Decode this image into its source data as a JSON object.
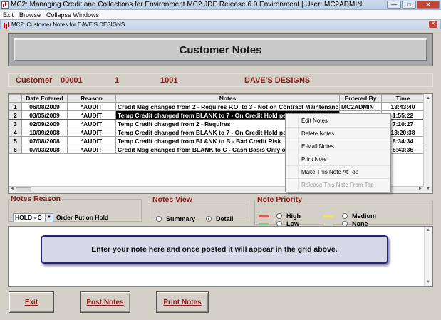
{
  "window": {
    "title": "MC2: Managing Credit and Collections for Environment MC2 JDE Release 6.0 Environment  |  User: MC2ADMIN",
    "minimize": "—",
    "maximize": "□",
    "close": "✕"
  },
  "menu": [
    "Exit",
    "Browse",
    "Collapse Windows"
  ],
  "child_window": {
    "title": "MC2: Customer Notes for DAVE'S DESIGNS",
    "close": "✕"
  },
  "header": {
    "title": "Customer Notes"
  },
  "customer": {
    "label": "Customer",
    "number": "00001",
    "field2": "1",
    "field3": "1001",
    "name": "DAVE'S DESIGNS"
  },
  "grid": {
    "columns": [
      "Date Entered",
      "Reason",
      "Notes",
      "Entered By",
      "Time"
    ],
    "rows": [
      {
        "n": "1",
        "date": "06/08/2009",
        "reason": "*AUDIT",
        "note": "Credit Msg changed from 2  - Requires P.O. to 3  - Not on Contract Maintenanc",
        "by": "MC2ADMIN",
        "time": "13:43:40"
      },
      {
        "n": "2",
        "date": "03/05/2009",
        "reason": "*AUDIT",
        "note": "Temp Credit changed from BLANK to 7  - On Credit Hold per",
        "by": "",
        "time": "1:55:22"
      },
      {
        "n": "3",
        "date": "02/09/2009",
        "reason": "*AUDIT",
        "note": "Temp Credit changed from 2  - Requires",
        "by": "",
        "time": "7:10:27"
      },
      {
        "n": "4",
        "date": "10/09/2008",
        "reason": "*AUDIT",
        "note": "Temp Credit changed from BLANK to 7  - On Credit Hold per",
        "by": "",
        "time": "13:20:38"
      },
      {
        "n": "5",
        "date": "07/08/2008",
        "reason": "*AUDIT",
        "note": "Temp Credit changed from BLANK to B  - Bad Credit Risk",
        "by": "",
        "time": "8:34:34"
      },
      {
        "n": "6",
        "date": "07/03/2008",
        "reason": "*AUDIT",
        "note": "Credit Msg changed from BLANK to C  - Cash Basis Only or C",
        "by": "",
        "time": "8:43:36"
      }
    ]
  },
  "context_menu": {
    "items": [
      "Edit Notes",
      "Delete Notes",
      "E-Mail Notes",
      "Print Note",
      "Make This Note At Top",
      "Release This Note From Top"
    ]
  },
  "notes_reason": {
    "legend": "Notes Reason",
    "code": "HOLD  - C",
    "description": "Order Put on Hold"
  },
  "notes_view": {
    "legend": "Notes View",
    "summary": "Summary",
    "detail": "Detail",
    "selected": "Detail"
  },
  "note_priority": {
    "legend": "Note Priority",
    "high": "High",
    "low": "Low",
    "medium": "Medium",
    "none": "None",
    "colors": {
      "high": "#e05a5a",
      "low": "#7acc7a",
      "medium": "#e8e070",
      "none": "#ffffff"
    }
  },
  "note_entry": {
    "hint": "Enter your note here and once posted it will appear in the grid above."
  },
  "buttons": {
    "exit": "Exit",
    "post": "Post Notes",
    "print": "Print Notes"
  }
}
